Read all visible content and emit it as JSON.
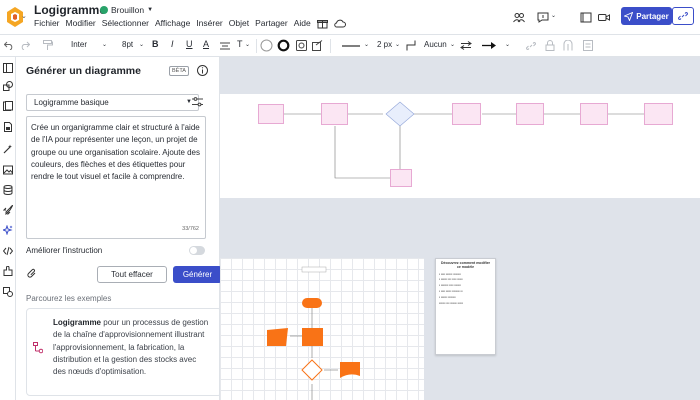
{
  "app": {
    "title": "Logigramme",
    "status": "Brouillon",
    "menu": [
      "Fichier",
      "Modifier",
      "Sélectionner",
      "Affichage",
      "Insérer",
      "Objet",
      "Partager",
      "Aide"
    ],
    "share_label": "Partager",
    "accent_color": "#3b4ec9"
  },
  "toolbar": {
    "font_family": "Inter",
    "font_size": "8pt",
    "bold": "B",
    "italic": "I",
    "underline": "U",
    "text_color": "A",
    "text_tool": "T",
    "line_width": "2 px",
    "arrow_start": "Aucun"
  },
  "panel": {
    "title": "Générer un diagramme",
    "beta": "BÊTA",
    "diagram_type": "Logigramme basique",
    "prompt": "Crée un organigramme clair et structuré à l'aide de l'IA pour représenter une leçon, un projet de groupe ou une organisation scolaire. Ajoute des couleurs, des flèches et des étiquettes pour rendre le tout visuel et facile à comprendre.",
    "char_count": "33/762",
    "improve_label": "Améliorer l'instruction",
    "clear_label": "Tout effacer",
    "generate_label": "Générer",
    "examples_label": "Parcourez les exemples",
    "example_title": "Logigramme",
    "example_body": " pour un processus de gestion de la chaîne d'approvisionnement illustrant l'approvisionnement, la fabrication, la distribution et la gestion des stocks avec des nœuds d'optimisation."
  },
  "canvas": {
    "note_title": "Découvrez comment modifier ce modèle",
    "node_color": "#fbe6f3",
    "flow_orange": "#f97316"
  }
}
